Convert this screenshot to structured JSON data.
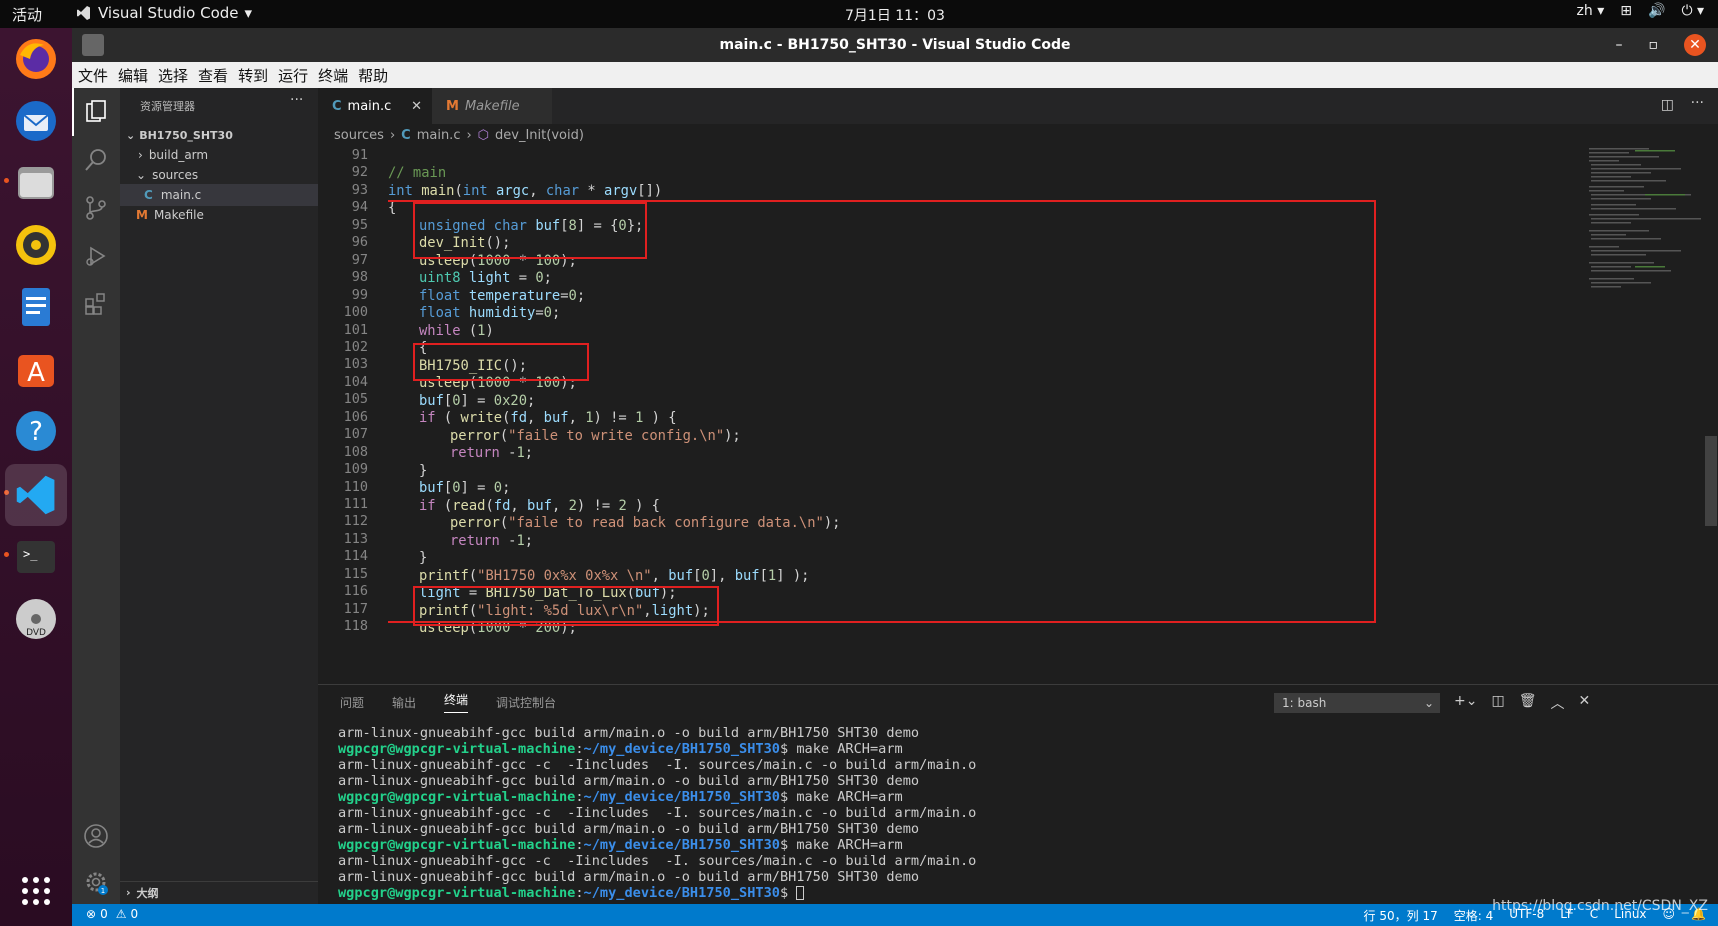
{
  "system_bar": {
    "activities": "活动",
    "app_name": "Visual Studio Code",
    "clock": "7月1日 11：03",
    "lang": "zh"
  },
  "window": {
    "title": "main.c - BH1750_SHT30 - Visual Studio Code"
  },
  "menu": [
    "文件",
    "编辑",
    "选择",
    "查看",
    "转到",
    "运行",
    "终端",
    "帮助"
  ],
  "explorer": {
    "header": "资源管理器",
    "project": "BH1750_SHT30",
    "items": [
      {
        "label": "build_arm",
        "type": "folder-collapsed"
      },
      {
        "label": "sources",
        "type": "folder-open"
      },
      {
        "label": "main.c",
        "type": "c-file"
      },
      {
        "label": "Makefile",
        "type": "makefile"
      }
    ],
    "outline": "大纲"
  },
  "tabs": [
    {
      "label": "main.c",
      "icon": "C",
      "active": true
    },
    {
      "label": "Makefile",
      "icon": "M",
      "active": false
    }
  ],
  "breadcrumb": {
    "folder": "sources",
    "file": "main.c",
    "symbol": "dev_Init(void)"
  },
  "code": {
    "line_numbers": [
      "91",
      "92",
      "93",
      "94",
      "95",
      "96",
      "97",
      "98",
      "99",
      "100",
      "101",
      "102",
      "103",
      "104",
      "105",
      "106",
      "107",
      "108",
      "109",
      "110",
      "111",
      "112",
      "113",
      "114",
      "115",
      "116",
      "117",
      "118"
    ]
  },
  "panel": {
    "tabs": [
      "问题",
      "输出",
      "终端",
      "调试控制台"
    ],
    "active_tab": "终端",
    "shell": "1: bash",
    "prompt_user": "wgpcgr@wgpcgr-virtual-machine",
    "prompt_path": "~/my_device/BH1750_SHT30",
    "cmd_make": "make ARCH=arm",
    "out_link": "arm-linux-gnueabihf-gcc build arm/main.o -o build arm/BH1750 SHT30 demo",
    "out_compile": "arm-linux-gnueabihf-gcc -c  -Iincludes  -I. sources/main.c -o build arm/main.o"
  },
  "status": {
    "errors": "0",
    "warnings": "0",
    "position": "行 50，列 17",
    "spaces": "空格: 4",
    "encoding": "UTF-8",
    "eol": "LF",
    "language": "C",
    "os": "Linux",
    "watermark": "https://blog.csdn.net/CSDN_XZ"
  },
  "colors": {
    "accent": "#007acc",
    "highlight_box": "#e02020"
  }
}
